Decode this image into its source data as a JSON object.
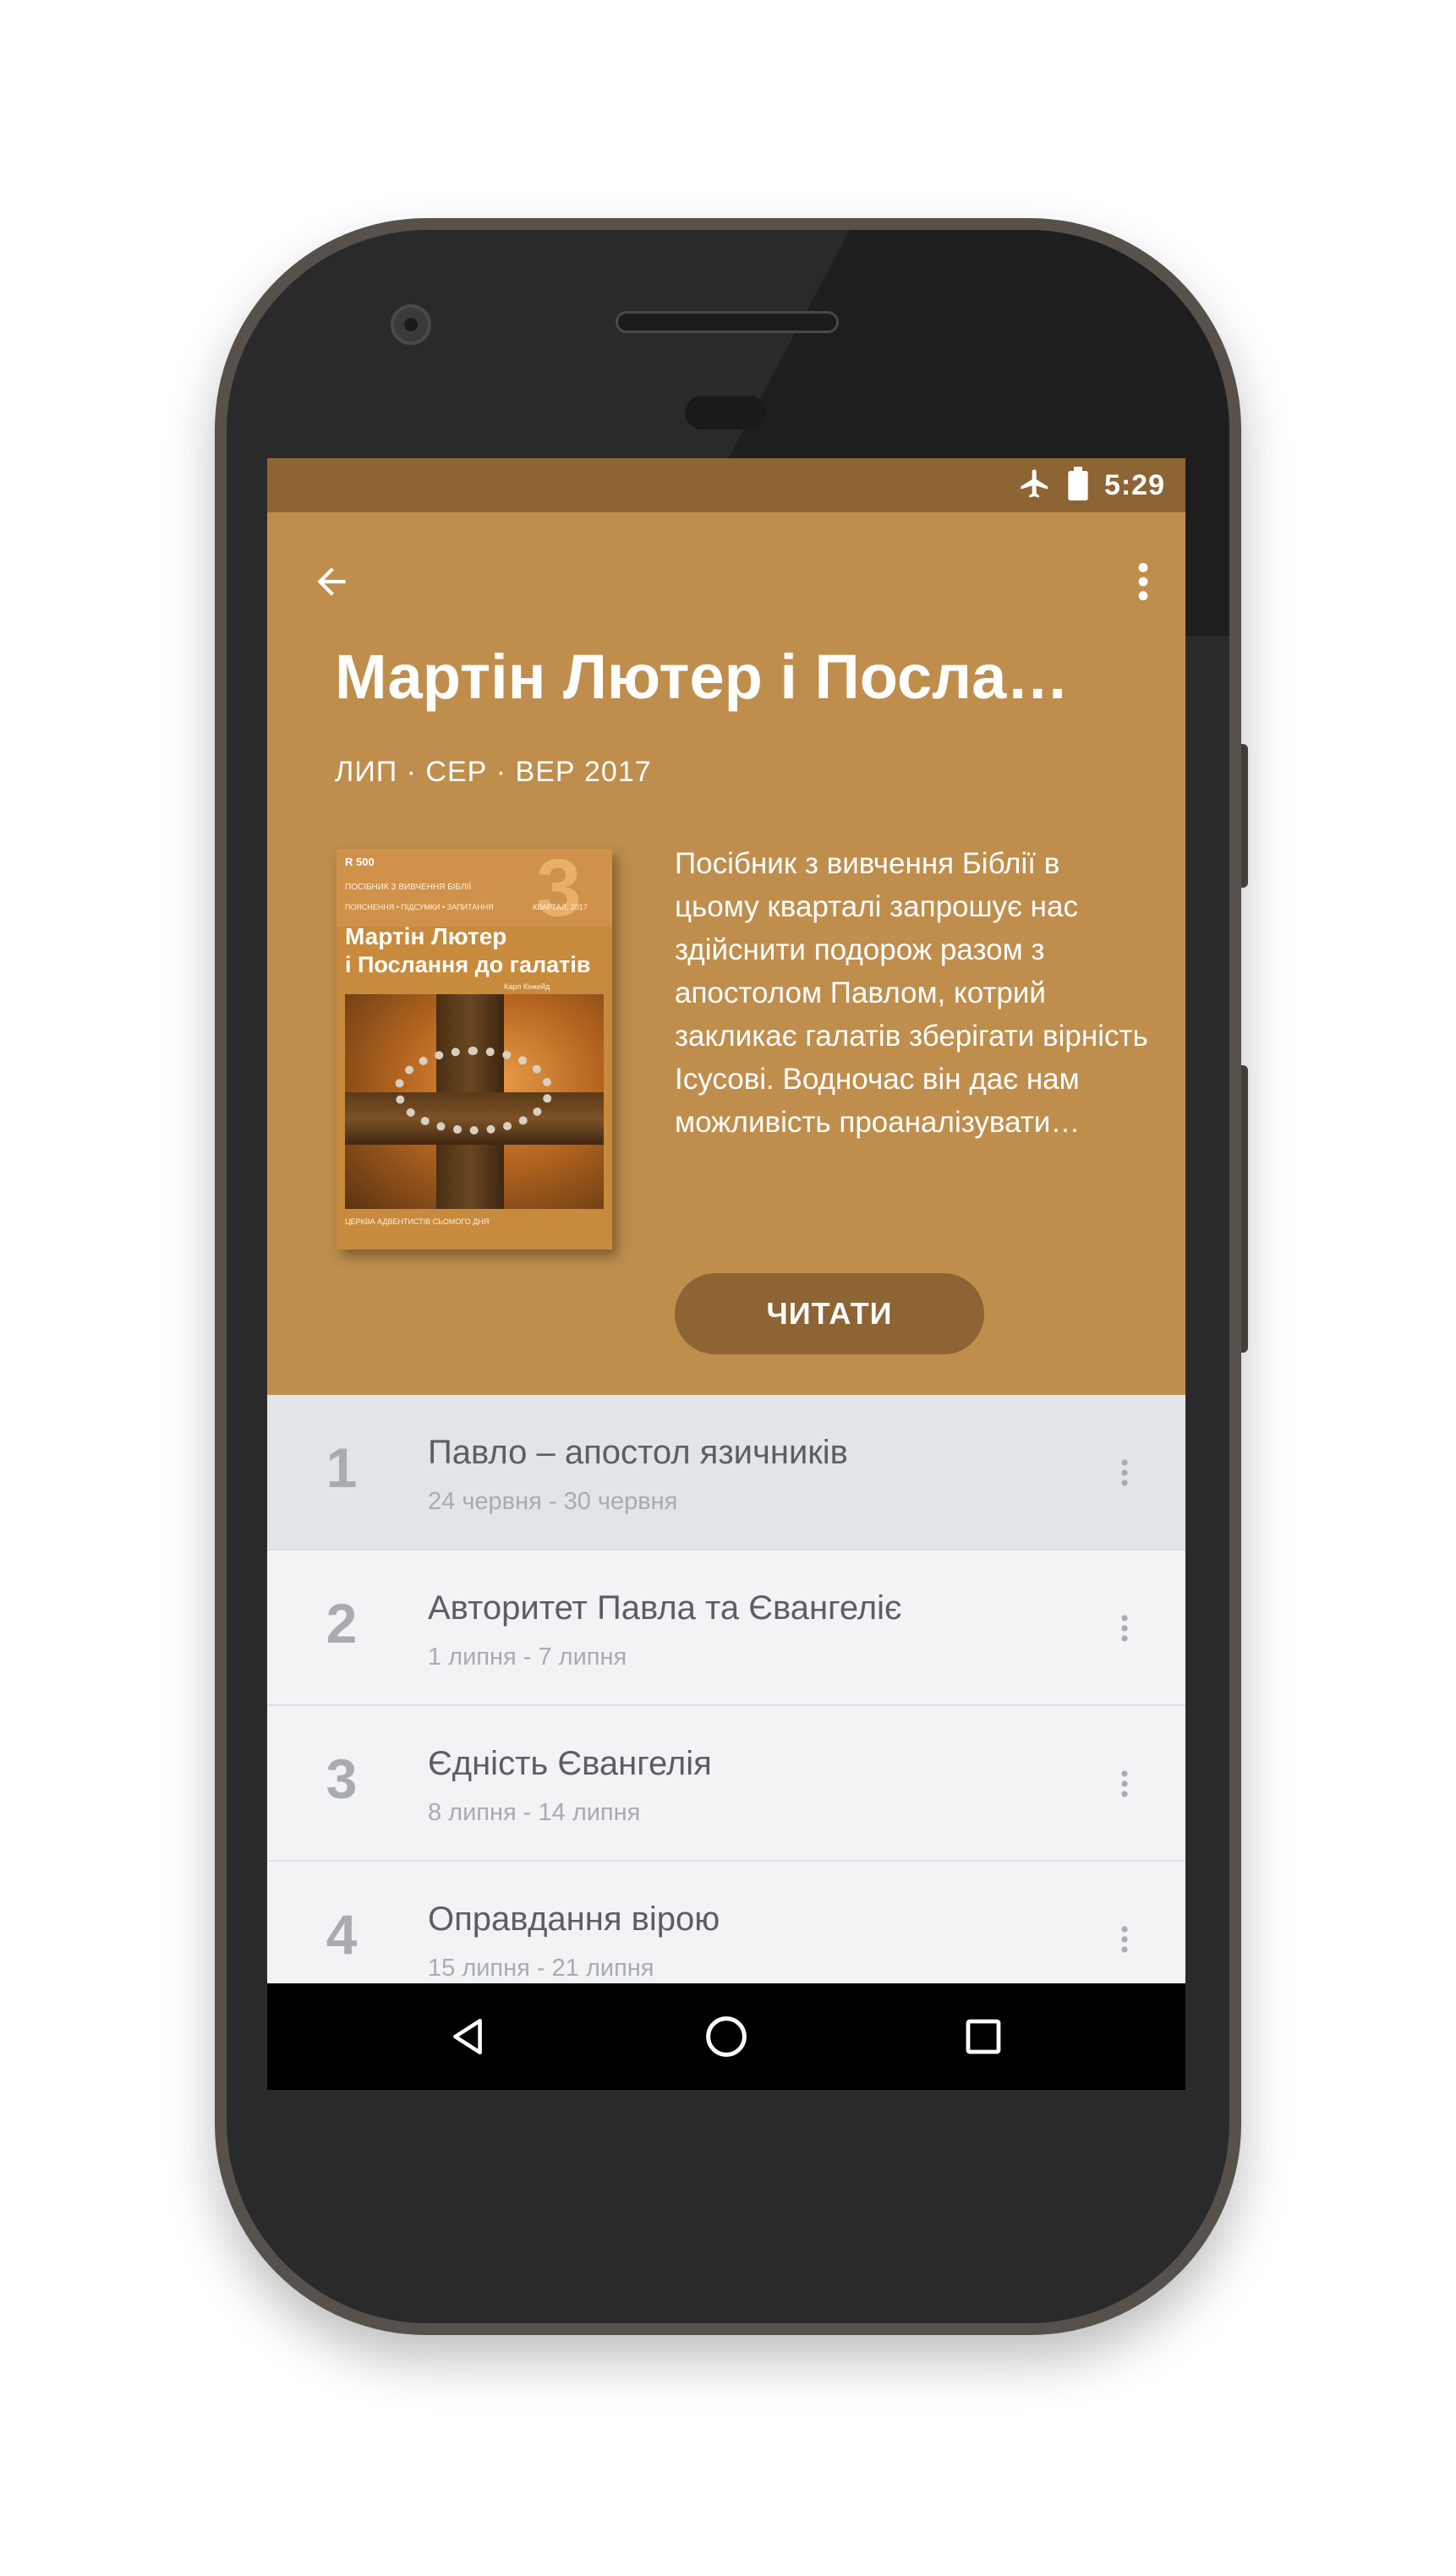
{
  "status_bar": {
    "time": "5:29",
    "icons": [
      "airplane-icon",
      "battery-icon"
    ]
  },
  "header": {
    "back_icon": "arrow-left-icon",
    "menu_icon": "more-vert-icon",
    "title": "Мартін Лютер і Посла…",
    "quarter": "ЛИП · СЕР · ВЕР 2017",
    "description": "Посібник з вивчення Біблії в цьому кварталі запрошує нас здійснити подорож разом з апостолом Павлом, котрий закликає галатів зберігати вірність Ісусові. Водночас він дає нам можливість проаналізувати…",
    "read_button": "ЧИТАТИ"
  },
  "cover": {
    "logo": "R 500",
    "subtitle1": "ПОСІБНИК З ВИВЧЕННЯ БІБЛІЇ",
    "subtitle2": "ПОЯСНЕННЯ • ПІДСУМКИ • ЗАПИТАННЯ",
    "number": "3",
    "quarter": "КВАРТАЛ, 2017",
    "title_line1": "Мартін Лютер",
    "title_line2": "і Послання до галатів",
    "author": "Карл Кінкейд",
    "church": "ЦЕРКВА АДВЕНТИСТІВ СЬОМОГО ДНЯ"
  },
  "lessons": [
    {
      "number": "1",
      "title": "Павло – апостол язичників",
      "dates": "24 червня - 30 червня",
      "active": true
    },
    {
      "number": "2",
      "title": "Авторитет Павла та Євангеліє",
      "dates": "1 липня - 7 липня",
      "active": false
    },
    {
      "number": "3",
      "title": "Єдність Євангелія",
      "dates": "8 липня - 14 липня",
      "active": false
    },
    {
      "number": "4",
      "title": "Оправдання вірою",
      "dates": "15 липня - 21 липня",
      "active": false
    }
  ],
  "nav_bar": {
    "icons": [
      "back-triangle-icon",
      "home-circle-icon",
      "recents-square-icon"
    ]
  },
  "colors": {
    "status_bar": "#8d6434",
    "header": "#bf8e4d",
    "button": "#8d6434",
    "list_bg": "#f1f3f5",
    "active_row": "#e2e5e7"
  }
}
